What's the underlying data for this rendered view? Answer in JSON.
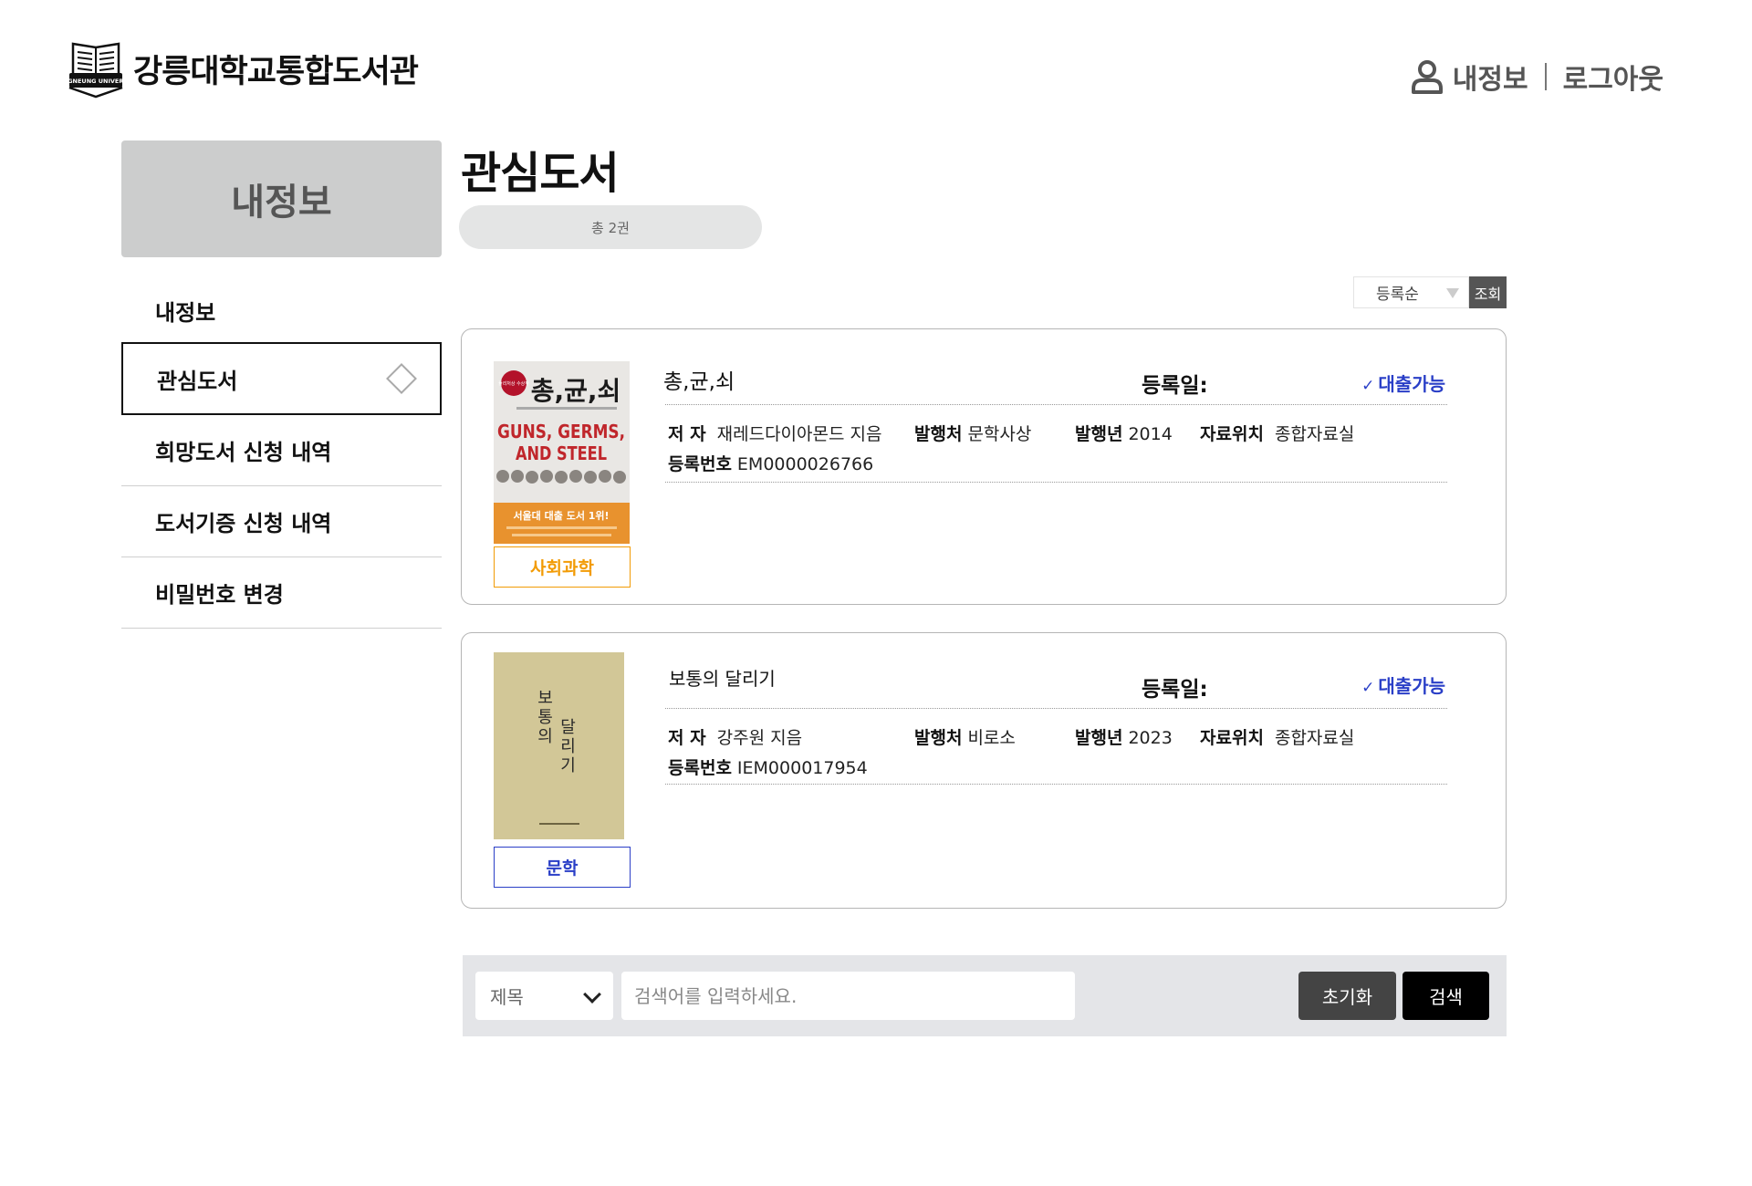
{
  "header": {
    "logo_text": "GANGNEUNG UNIVERSITY",
    "title": "강릉대학교통합도서관",
    "my_info": "내정보",
    "logout": "로그아웃"
  },
  "sidebar": {
    "heading": "내정보",
    "items": [
      {
        "label": "내정보"
      },
      {
        "label": "관심도서",
        "active": true
      },
      {
        "label": "희망도서 신청 내역"
      },
      {
        "label": "도서기증 신청 내역"
      },
      {
        "label": "비밀번호 변경"
      }
    ]
  },
  "main": {
    "title": "관심도서",
    "count": "총 2권",
    "sort": {
      "selected": "등록순",
      "button": "조회"
    }
  },
  "labels": {
    "reg_date": "등록일:",
    "author": "저 자",
    "publisher": "발행처",
    "year": "발행년",
    "location": "자료위치",
    "reg_no": "등록번호"
  },
  "books": [
    {
      "title": "총,균,쇠",
      "availability": "대출가능",
      "author": "재레드다이아몬드 지음",
      "publisher": "문학사상",
      "year": "2014",
      "location": "종합자료실",
      "reg_no": "EM0000026766",
      "category": "사회과학",
      "category_color": "#f29b05",
      "cover": {
        "badge": "퓰리처상 수상작",
        "title_ko": "총,균,쇠",
        "title_en_1": "GUNS, GERMS,",
        "title_en_2": "AND STEEL",
        "tagline": "서울대 대출 도서 1위!"
      }
    },
    {
      "title": "보통의 달리기",
      "availability": "대출가능",
      "author": "강주원 지음",
      "publisher": "비로소",
      "year": "2023",
      "location": "종합자료실",
      "reg_no": "IEM000017954",
      "category": "문학",
      "category_color": "#2a3fc7",
      "cover": {
        "title_col_1": "보통의",
        "title_col_2": "달리기"
      }
    }
  ],
  "search": {
    "field": "제목",
    "placeholder": "검색어를 입력하세요.",
    "reset": "초기화",
    "submit": "검색"
  }
}
